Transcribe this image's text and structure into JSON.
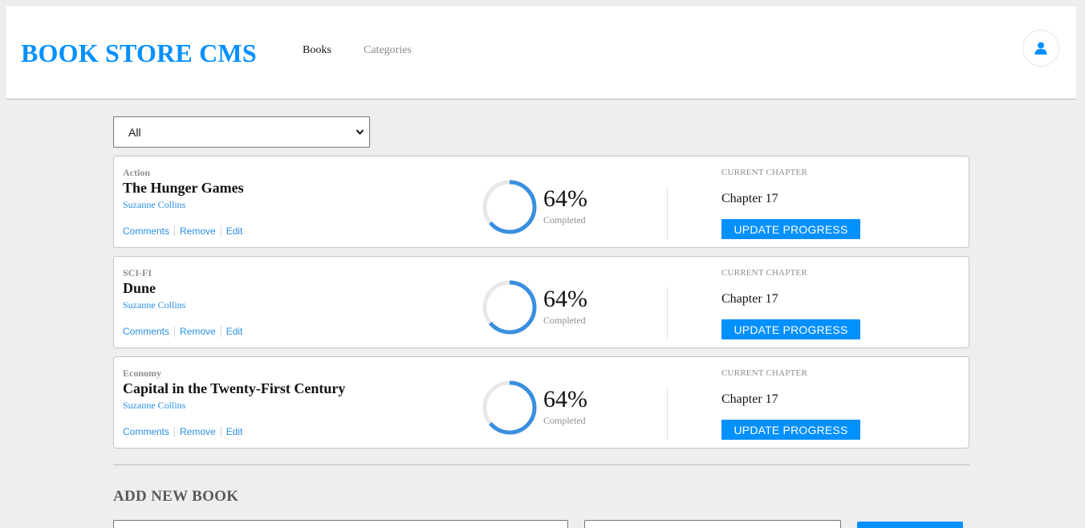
{
  "header": {
    "logo": "BOOK STORE CMS",
    "nav": [
      {
        "label": "Books"
      },
      {
        "label": "Categories"
      }
    ]
  },
  "filter": {
    "selected": "All"
  },
  "books": [
    {
      "category": "Action",
      "title": "The Hunger Games",
      "author": "Suzanne Collins",
      "actions": [
        "Comments",
        "Remove",
        "Edit"
      ],
      "percent_text": "64%",
      "progress_fraction": 0.64,
      "completed_label": "Completed",
      "chapter_label": "CURRENT CHAPTER",
      "chapter": "Chapter 17",
      "update_label": "UPDATE PROGRESS"
    },
    {
      "category": "SCI-FI",
      "title": "Dune",
      "author": "Suzanne Collins",
      "actions": [
        "Comments",
        "Remove",
        "Edit"
      ],
      "percent_text": "64%",
      "progress_fraction": 0.64,
      "completed_label": "Completed",
      "chapter_label": "CURRENT CHAPTER",
      "chapter": "Chapter 17",
      "update_label": "UPDATE PROGRESS"
    },
    {
      "category": "Economy",
      "title": "Capital in the Twenty-First Century",
      "author": "Suzanne Collins",
      "actions": [
        "Comments",
        "Remove",
        "Edit"
      ],
      "percent_text": "64%",
      "progress_fraction": 0.64,
      "completed_label": "Completed",
      "chapter_label": "CURRENT CHAPTER",
      "chapter": "Chapter 17",
      "update_label": "UPDATE PROGRESS"
    }
  ],
  "add_book": {
    "heading": "ADD NEW BOOK"
  },
  "colors": {
    "accent": "#0290ff",
    "link": "#2b8fe6",
    "ring_track": "#e8e8e8",
    "ring_fill": "#3a8fdf",
    "background": "#efeeef"
  },
  "icons": {
    "avatar": "user-icon",
    "select": "chevron-down-icon"
  }
}
